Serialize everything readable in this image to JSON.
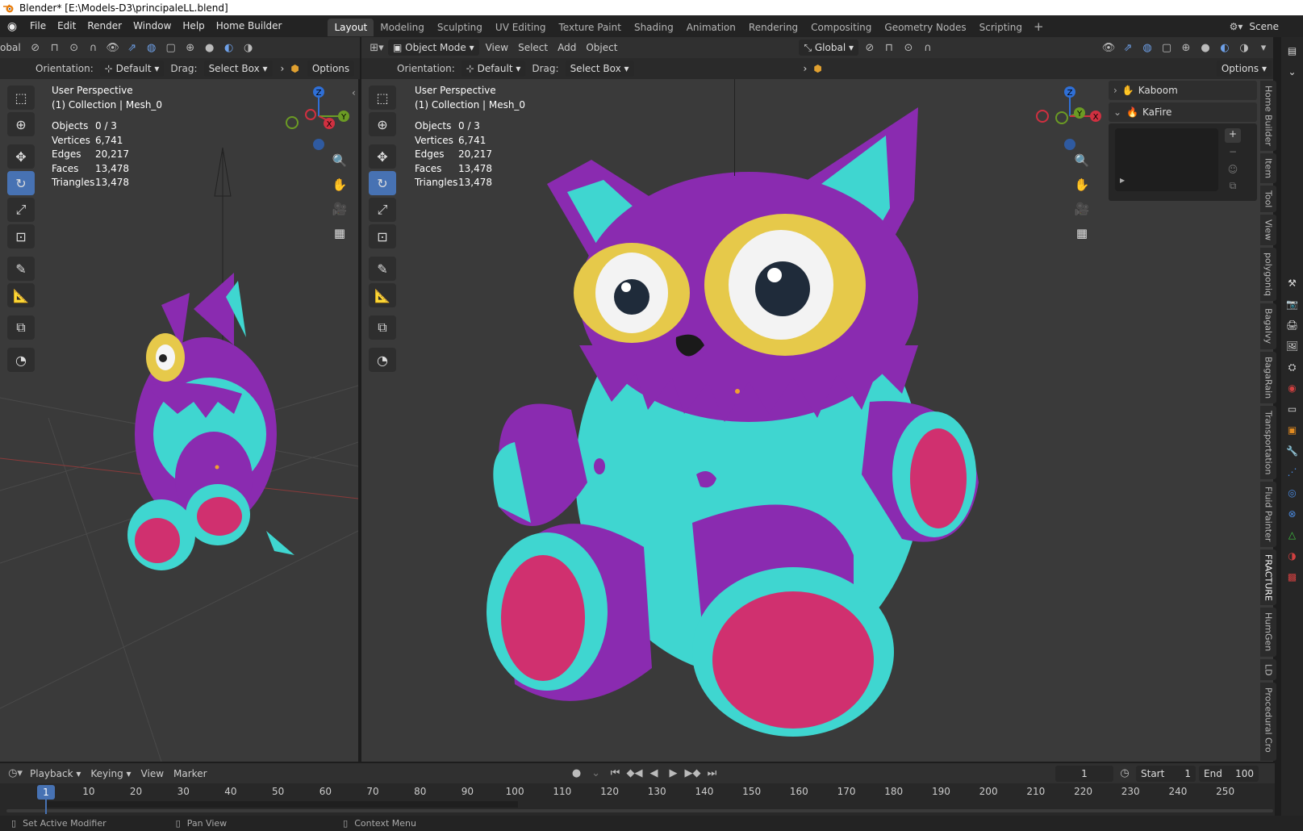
{
  "window": {
    "title": "Blender* [E:\\Models-D3\\principaleLL.blend]"
  },
  "menu": [
    "File",
    "Edit",
    "Render",
    "Window",
    "Help",
    "Home Builder"
  ],
  "workspaces": [
    "Layout",
    "Modeling",
    "Sculpting",
    "UV Editing",
    "Texture Paint",
    "Shading",
    "Animation",
    "Rendering",
    "Compositing",
    "Geometry Nodes",
    "Scripting"
  ],
  "active_workspace": "Layout",
  "scene_label": "Scene",
  "left_view": {
    "header_left": "obal",
    "orientation_label": "Orientation:",
    "orientation_value": "Default",
    "drag_label": "Drag:",
    "drag_value": "Select Box",
    "options": "Options",
    "perspective": "User Perspective",
    "collection": "(1) Collection | Mesh_0"
  },
  "main_view": {
    "mode": "Object Mode",
    "menus": [
      "View",
      "Select",
      "Add",
      "Object"
    ],
    "transform": "Global",
    "orientation_label": "Orientation:",
    "orientation_value": "Default",
    "drag_label": "Drag:",
    "drag_value": "Select Box",
    "options": "Options",
    "perspective": "User Perspective",
    "collection": "(1) Collection | Mesh_0"
  },
  "stats": [
    {
      "label": "Objects",
      "value": "0 / 3"
    },
    {
      "label": "Vertices",
      "value": "6,741"
    },
    {
      "label": "Edges",
      "value": "20,217"
    },
    {
      "label": "Faces",
      "value": "13,478"
    },
    {
      "label": "Triangles",
      "value": "13,478"
    }
  ],
  "gizmo": {
    "z": "Z",
    "y": "Y",
    "x": "X"
  },
  "sidebar_panels": [
    {
      "label": "Kaboom",
      "icon": "hand-icon"
    },
    {
      "label": "KaFire",
      "icon": "fire-icon"
    }
  ],
  "sidebar_tabs": [
    "Home Builder",
    "Item",
    "Tool",
    "View",
    "polygoniq",
    "Bagalvy",
    "BagaRain",
    "Transportation",
    "Fluid Painter",
    "FRACTURE",
    "HumGen",
    "LD",
    "Procedural Cro"
  ],
  "timeline": {
    "menus": [
      "Playback",
      "Keying",
      "View",
      "Marker"
    ],
    "current_frame": "1",
    "start_label": "Start",
    "start": "1",
    "end_label": "End",
    "end": "100",
    "ticks": [
      "1",
      "10",
      "20",
      "30",
      "40",
      "50",
      "60",
      "70",
      "80",
      "90",
      "100",
      "110",
      "120",
      "130",
      "140",
      "150",
      "160",
      "170",
      "180",
      "190",
      "200",
      "210",
      "220",
      "230",
      "240",
      "250"
    ]
  },
  "status": [
    "Set Active Modifier",
    "Pan View",
    "Context Menu"
  ],
  "colors": {
    "accent": "#4772b3",
    "toy_purple": "#8a2bb0",
    "toy_cyan": "#3fd6d0",
    "toy_pink": "#d0306f"
  }
}
